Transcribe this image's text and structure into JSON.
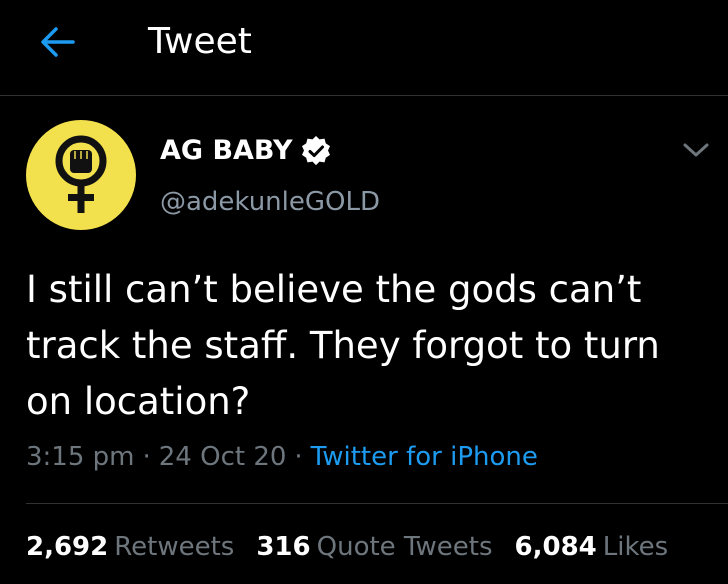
{
  "header": {
    "title": "Tweet",
    "back_icon": "arrow-left-icon",
    "accent_color": "#1d9bf0"
  },
  "author": {
    "name": "AG BABY",
    "handle": "@adekunleGOLD",
    "verified": true,
    "avatar_bg": "#f2e04c",
    "avatar_icon": "female-fist-symbol-icon"
  },
  "tweet": {
    "text": "I still can’t believe the gods can’t track the staff. They forgot to turn on location?",
    "time": "3:15 pm",
    "date": "24 Oct 20",
    "separator": "·",
    "source": "Twitter for iPhone"
  },
  "stats": {
    "retweets_count": "2,692",
    "retweets_label": "Retweets",
    "quotes_count": "316",
    "quotes_label": "Quote Tweets",
    "likes_count": "6,084",
    "likes_label": "Likes"
  }
}
